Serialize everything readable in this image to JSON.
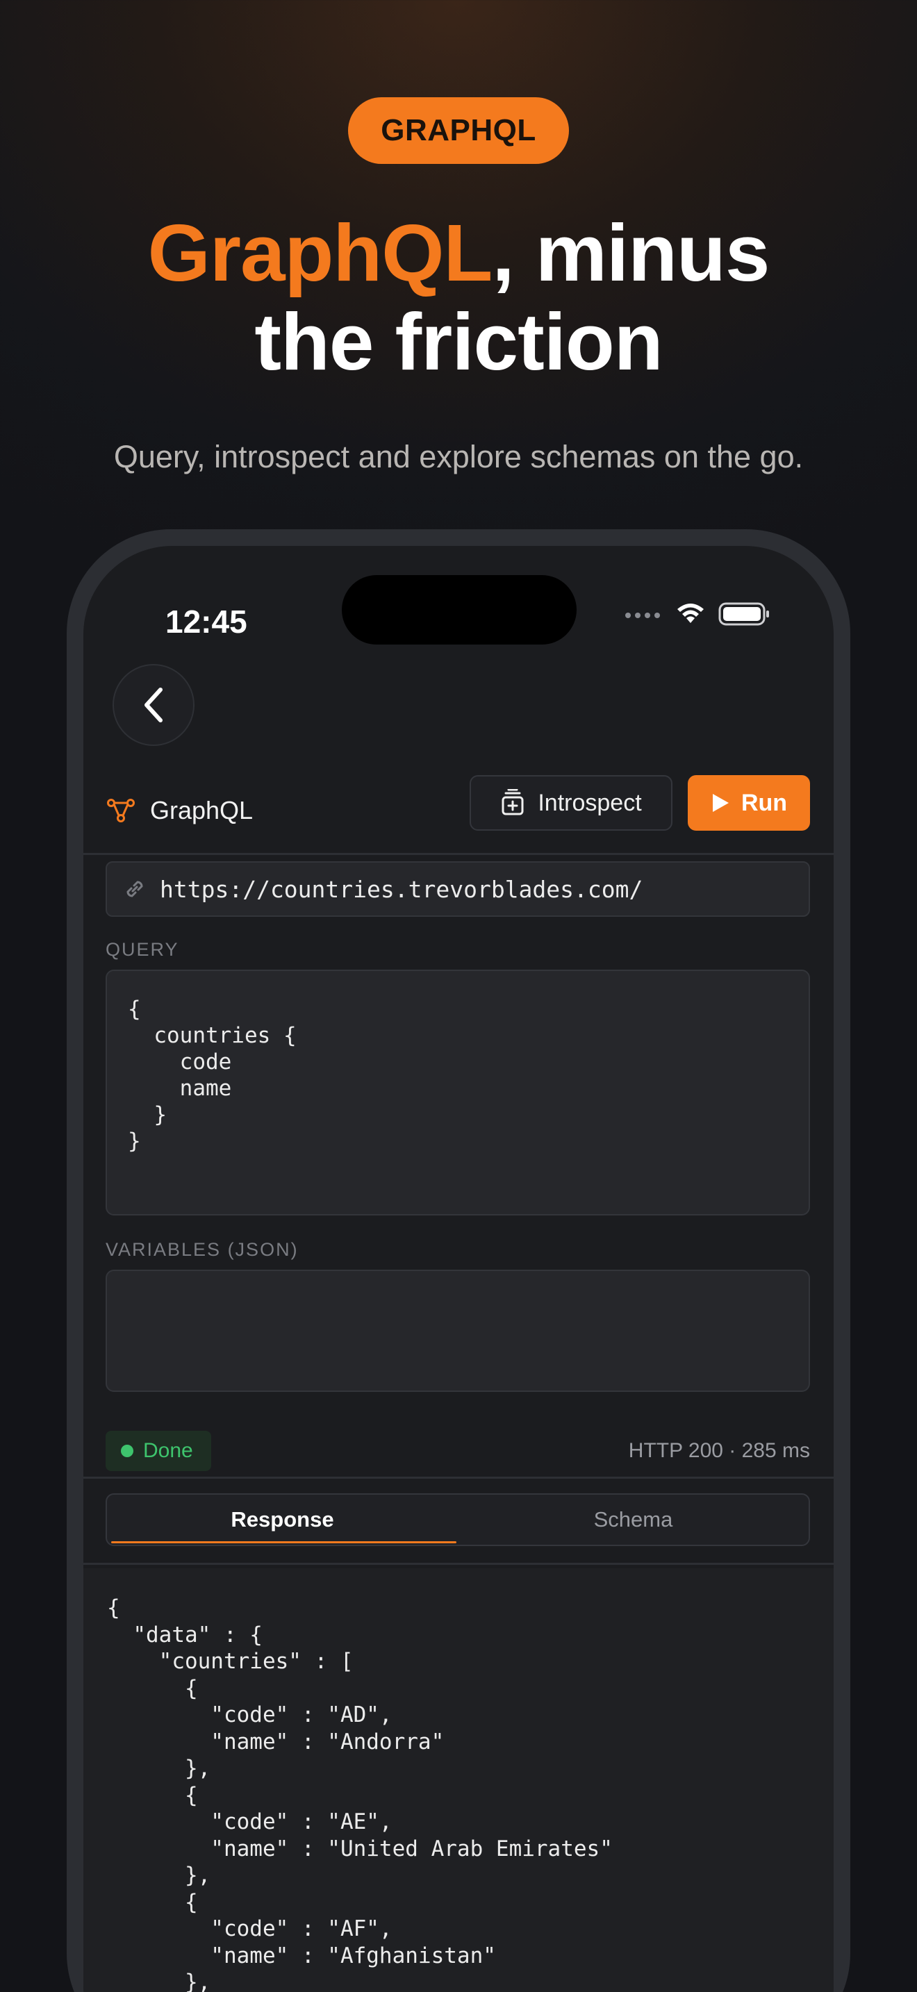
{
  "hero": {
    "badge": "GRAPHQL",
    "headline_accent": "GraphQL",
    "headline_rest_line1": ", minus",
    "headline_line2": "the friction",
    "subhead": "Query, introspect and explore schemas on the go."
  },
  "status_bar": {
    "time": "12:45"
  },
  "toolbar": {
    "title": "GraphQL",
    "introspect_label": "Introspect",
    "run_label": "Run"
  },
  "endpoint": {
    "url": "https://countries.trevorblades.com/"
  },
  "query": {
    "label": "QUERY",
    "text": "{\n  countries {\n    code\n    name\n  }\n}"
  },
  "variables": {
    "label": "VARIABLES (JSON)",
    "text": ""
  },
  "result": {
    "status": "Done",
    "meta": "HTTP 200 · 285 ms"
  },
  "tabs": {
    "response": "Response",
    "schema": "Schema",
    "selected": "Response"
  },
  "response": {
    "text": "{\n  \"data\" : {\n    \"countries\" : [\n      {\n        \"code\" : \"AD\",\n        \"name\" : \"Andorra\"\n      },\n      {\n        \"code\" : \"AE\",\n        \"name\" : \"United Arab Emirates\"\n      },\n      {\n        \"code\" : \"AF\",\n        \"name\" : \"Afghanistan\"\n      },\n      {"
  },
  "colors": {
    "accent": "#f47a1e",
    "success": "#3ec46d",
    "background": "#1b1c1f"
  }
}
